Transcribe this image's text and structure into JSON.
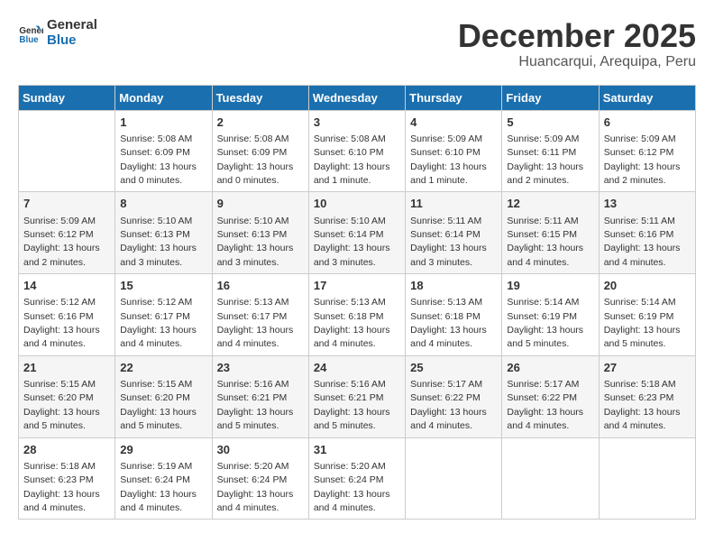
{
  "header": {
    "logo_general": "General",
    "logo_blue": "Blue",
    "month": "December 2025",
    "location": "Huancarqui, Arequipa, Peru"
  },
  "weekdays": [
    "Sunday",
    "Monday",
    "Tuesday",
    "Wednesday",
    "Thursday",
    "Friday",
    "Saturday"
  ],
  "weeks": [
    [
      {
        "day": "",
        "sunrise": "",
        "sunset": "",
        "daylight": ""
      },
      {
        "day": "1",
        "sunrise": "Sunrise: 5:08 AM",
        "sunset": "Sunset: 6:09 PM",
        "daylight": "Daylight: 13 hours and 0 minutes."
      },
      {
        "day": "2",
        "sunrise": "Sunrise: 5:08 AM",
        "sunset": "Sunset: 6:09 PM",
        "daylight": "Daylight: 13 hours and 0 minutes."
      },
      {
        "day": "3",
        "sunrise": "Sunrise: 5:08 AM",
        "sunset": "Sunset: 6:10 PM",
        "daylight": "Daylight: 13 hours and 1 minute."
      },
      {
        "day": "4",
        "sunrise": "Sunrise: 5:09 AM",
        "sunset": "Sunset: 6:10 PM",
        "daylight": "Daylight: 13 hours and 1 minute."
      },
      {
        "day": "5",
        "sunrise": "Sunrise: 5:09 AM",
        "sunset": "Sunset: 6:11 PM",
        "daylight": "Daylight: 13 hours and 2 minutes."
      },
      {
        "day": "6",
        "sunrise": "Sunrise: 5:09 AM",
        "sunset": "Sunset: 6:12 PM",
        "daylight": "Daylight: 13 hours and 2 minutes."
      }
    ],
    [
      {
        "day": "7",
        "sunrise": "Sunrise: 5:09 AM",
        "sunset": "Sunset: 6:12 PM",
        "daylight": "Daylight: 13 hours and 2 minutes."
      },
      {
        "day": "8",
        "sunrise": "Sunrise: 5:10 AM",
        "sunset": "Sunset: 6:13 PM",
        "daylight": "Daylight: 13 hours and 3 minutes."
      },
      {
        "day": "9",
        "sunrise": "Sunrise: 5:10 AM",
        "sunset": "Sunset: 6:13 PM",
        "daylight": "Daylight: 13 hours and 3 minutes."
      },
      {
        "day": "10",
        "sunrise": "Sunrise: 5:10 AM",
        "sunset": "Sunset: 6:14 PM",
        "daylight": "Daylight: 13 hours and 3 minutes."
      },
      {
        "day": "11",
        "sunrise": "Sunrise: 5:11 AM",
        "sunset": "Sunset: 6:14 PM",
        "daylight": "Daylight: 13 hours and 3 minutes."
      },
      {
        "day": "12",
        "sunrise": "Sunrise: 5:11 AM",
        "sunset": "Sunset: 6:15 PM",
        "daylight": "Daylight: 13 hours and 4 minutes."
      },
      {
        "day": "13",
        "sunrise": "Sunrise: 5:11 AM",
        "sunset": "Sunset: 6:16 PM",
        "daylight": "Daylight: 13 hours and 4 minutes."
      }
    ],
    [
      {
        "day": "14",
        "sunrise": "Sunrise: 5:12 AM",
        "sunset": "Sunset: 6:16 PM",
        "daylight": "Daylight: 13 hours and 4 minutes."
      },
      {
        "day": "15",
        "sunrise": "Sunrise: 5:12 AM",
        "sunset": "Sunset: 6:17 PM",
        "daylight": "Daylight: 13 hours and 4 minutes."
      },
      {
        "day": "16",
        "sunrise": "Sunrise: 5:13 AM",
        "sunset": "Sunset: 6:17 PM",
        "daylight": "Daylight: 13 hours and 4 minutes."
      },
      {
        "day": "17",
        "sunrise": "Sunrise: 5:13 AM",
        "sunset": "Sunset: 6:18 PM",
        "daylight": "Daylight: 13 hours and 4 minutes."
      },
      {
        "day": "18",
        "sunrise": "Sunrise: 5:13 AM",
        "sunset": "Sunset: 6:18 PM",
        "daylight": "Daylight: 13 hours and 4 minutes."
      },
      {
        "day": "19",
        "sunrise": "Sunrise: 5:14 AM",
        "sunset": "Sunset: 6:19 PM",
        "daylight": "Daylight: 13 hours and 5 minutes."
      },
      {
        "day": "20",
        "sunrise": "Sunrise: 5:14 AM",
        "sunset": "Sunset: 6:19 PM",
        "daylight": "Daylight: 13 hours and 5 minutes."
      }
    ],
    [
      {
        "day": "21",
        "sunrise": "Sunrise: 5:15 AM",
        "sunset": "Sunset: 6:20 PM",
        "daylight": "Daylight: 13 hours and 5 minutes."
      },
      {
        "day": "22",
        "sunrise": "Sunrise: 5:15 AM",
        "sunset": "Sunset: 6:20 PM",
        "daylight": "Daylight: 13 hours and 5 minutes."
      },
      {
        "day": "23",
        "sunrise": "Sunrise: 5:16 AM",
        "sunset": "Sunset: 6:21 PM",
        "daylight": "Daylight: 13 hours and 5 minutes."
      },
      {
        "day": "24",
        "sunrise": "Sunrise: 5:16 AM",
        "sunset": "Sunset: 6:21 PM",
        "daylight": "Daylight: 13 hours and 5 minutes."
      },
      {
        "day": "25",
        "sunrise": "Sunrise: 5:17 AM",
        "sunset": "Sunset: 6:22 PM",
        "daylight": "Daylight: 13 hours and 4 minutes."
      },
      {
        "day": "26",
        "sunrise": "Sunrise: 5:17 AM",
        "sunset": "Sunset: 6:22 PM",
        "daylight": "Daylight: 13 hours and 4 minutes."
      },
      {
        "day": "27",
        "sunrise": "Sunrise: 5:18 AM",
        "sunset": "Sunset: 6:23 PM",
        "daylight": "Daylight: 13 hours and 4 minutes."
      }
    ],
    [
      {
        "day": "28",
        "sunrise": "Sunrise: 5:18 AM",
        "sunset": "Sunset: 6:23 PM",
        "daylight": "Daylight: 13 hours and 4 minutes."
      },
      {
        "day": "29",
        "sunrise": "Sunrise: 5:19 AM",
        "sunset": "Sunset: 6:24 PM",
        "daylight": "Daylight: 13 hours and 4 minutes."
      },
      {
        "day": "30",
        "sunrise": "Sunrise: 5:20 AM",
        "sunset": "Sunset: 6:24 PM",
        "daylight": "Daylight: 13 hours and 4 minutes."
      },
      {
        "day": "31",
        "sunrise": "Sunrise: 5:20 AM",
        "sunset": "Sunset: 6:24 PM",
        "daylight": "Daylight: 13 hours and 4 minutes."
      },
      {
        "day": "",
        "sunrise": "",
        "sunset": "",
        "daylight": ""
      },
      {
        "day": "",
        "sunrise": "",
        "sunset": "",
        "daylight": ""
      },
      {
        "day": "",
        "sunrise": "",
        "sunset": "",
        "daylight": ""
      }
    ]
  ]
}
